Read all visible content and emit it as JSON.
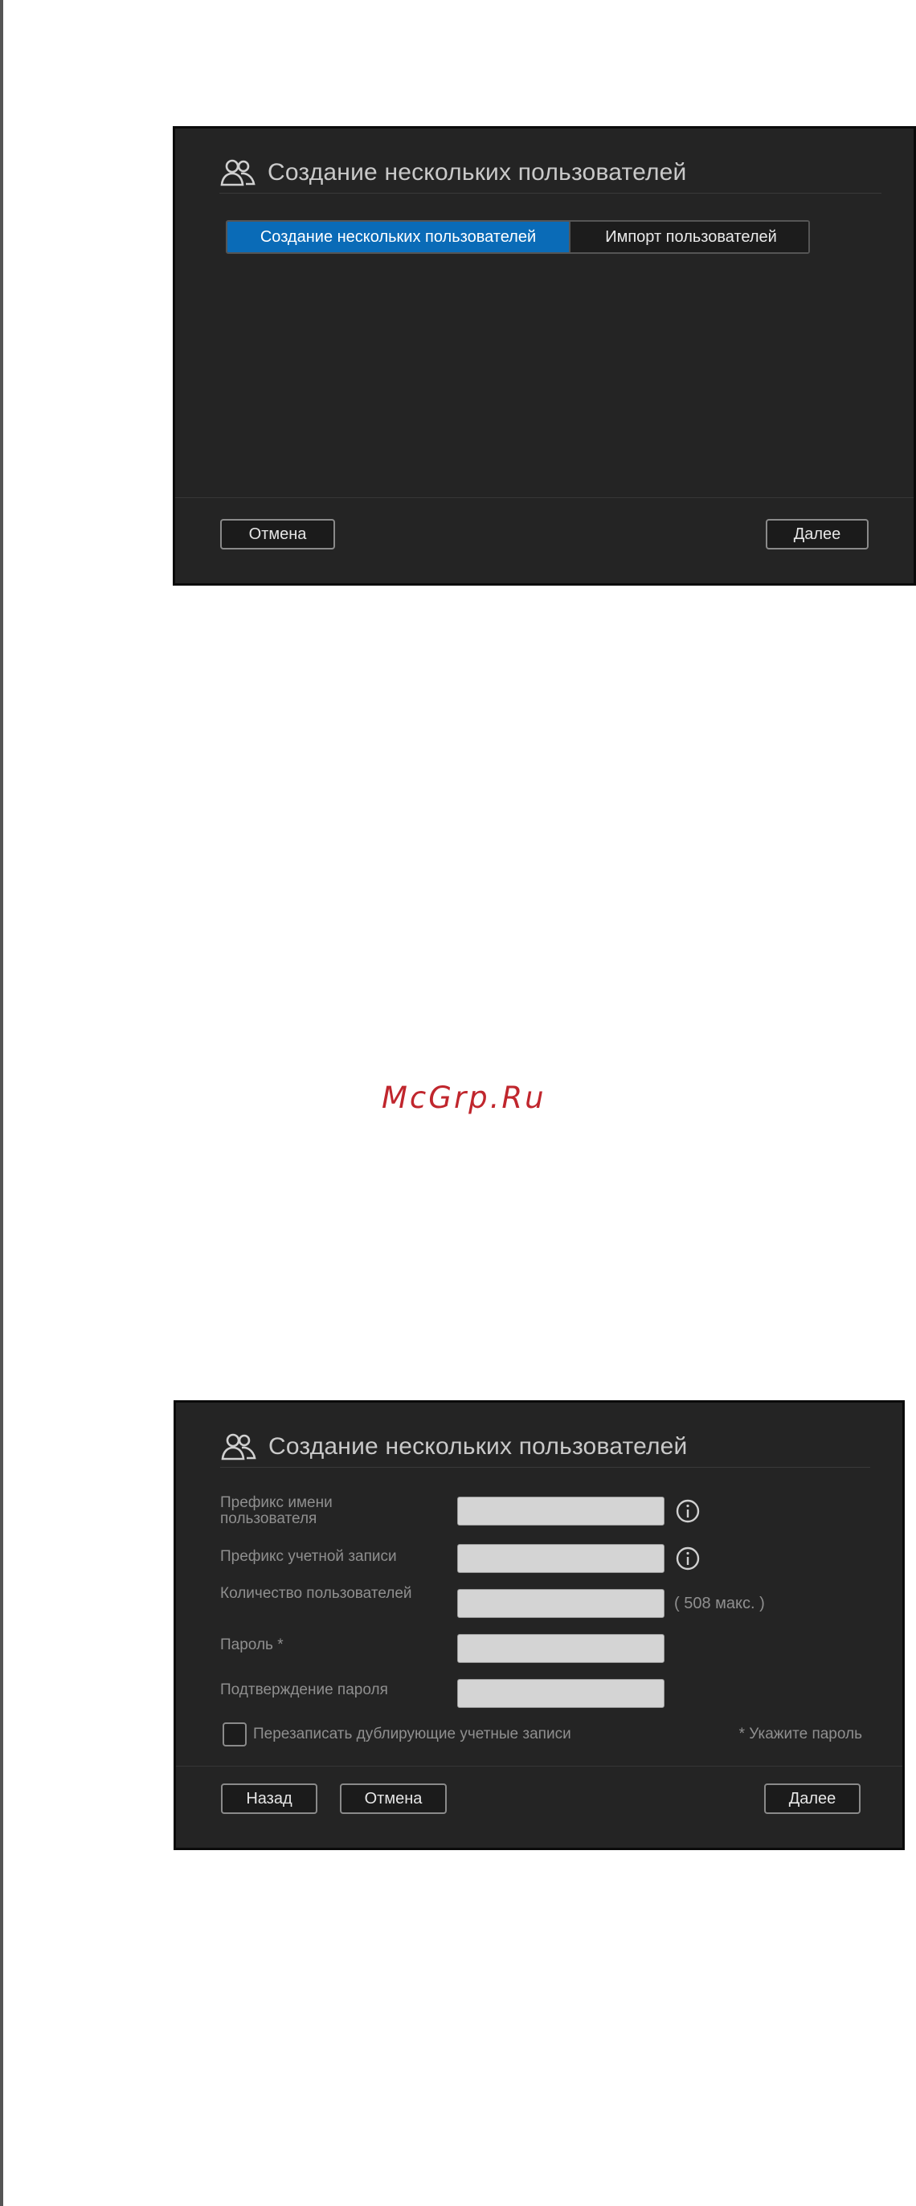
{
  "watermark": "McGrp.Ru",
  "dialog1": {
    "title": "Создание нескольких пользователей",
    "tabs": [
      {
        "label": "Создание нескольких пользователей",
        "active": true
      },
      {
        "label": "Импорт пользователей",
        "active": false
      }
    ],
    "cancel_label": "Отмена",
    "next_label": "Далее"
  },
  "dialog2": {
    "title": "Создание нескольких пользователей",
    "fields": {
      "username_prefix": {
        "label": "Префикс имени пользователя",
        "value": ""
      },
      "account_prefix": {
        "label": "Префикс учетной записи",
        "value": ""
      },
      "user_count": {
        "label": "Количество пользователей",
        "value": "",
        "hint": "( 508 макс. )"
      },
      "password": {
        "label": "Пароль *",
        "value": ""
      },
      "password_confirm": {
        "label": "Подтверждение пароля",
        "value": ""
      }
    },
    "overwrite_label": "Перезаписать дублирующие учетные записи",
    "overwrite_checked": false,
    "required_note": "* Укажите пароль",
    "back_label": "Назад",
    "cancel_label": "Отмена",
    "next_label": "Далее"
  },
  "colors": {
    "dialog_bg": "#242424",
    "accent": "#0a6bb7",
    "watermark": "#c0262d"
  },
  "icons": {
    "header": "users-icon",
    "info": "info-icon"
  }
}
